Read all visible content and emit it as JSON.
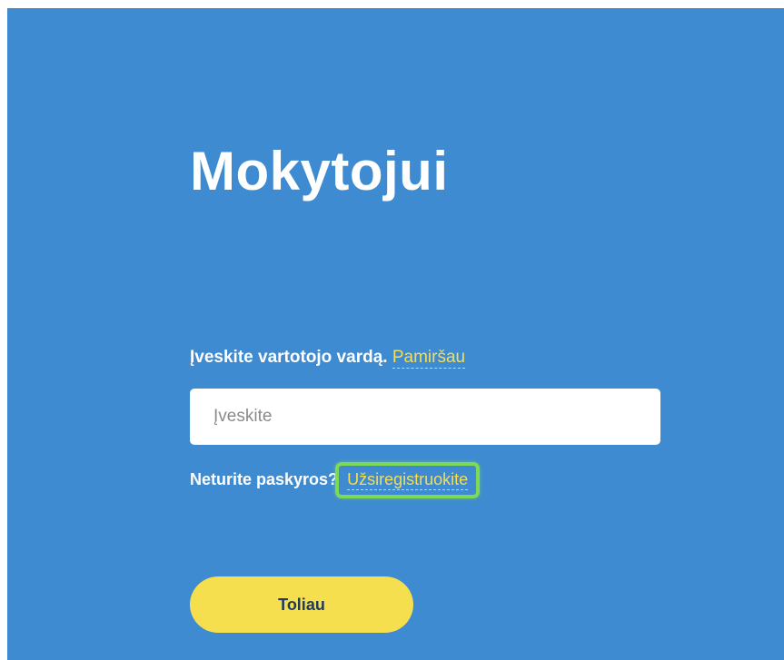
{
  "page": {
    "title": "Mokytojui"
  },
  "username": {
    "label": "Įveskite vartotojo vardą.",
    "forgot_link": "Pamiršau",
    "placeholder": "Įveskite",
    "value": ""
  },
  "register": {
    "prompt": "Neturite paskyros?",
    "link": "Užsiregistruokite"
  },
  "actions": {
    "next_label": "Toliau"
  },
  "colors": {
    "panel_bg": "#3e8bd1",
    "link": "#f6dd53",
    "button_bg": "#f6df4f",
    "highlight_border": "#7ed957"
  }
}
